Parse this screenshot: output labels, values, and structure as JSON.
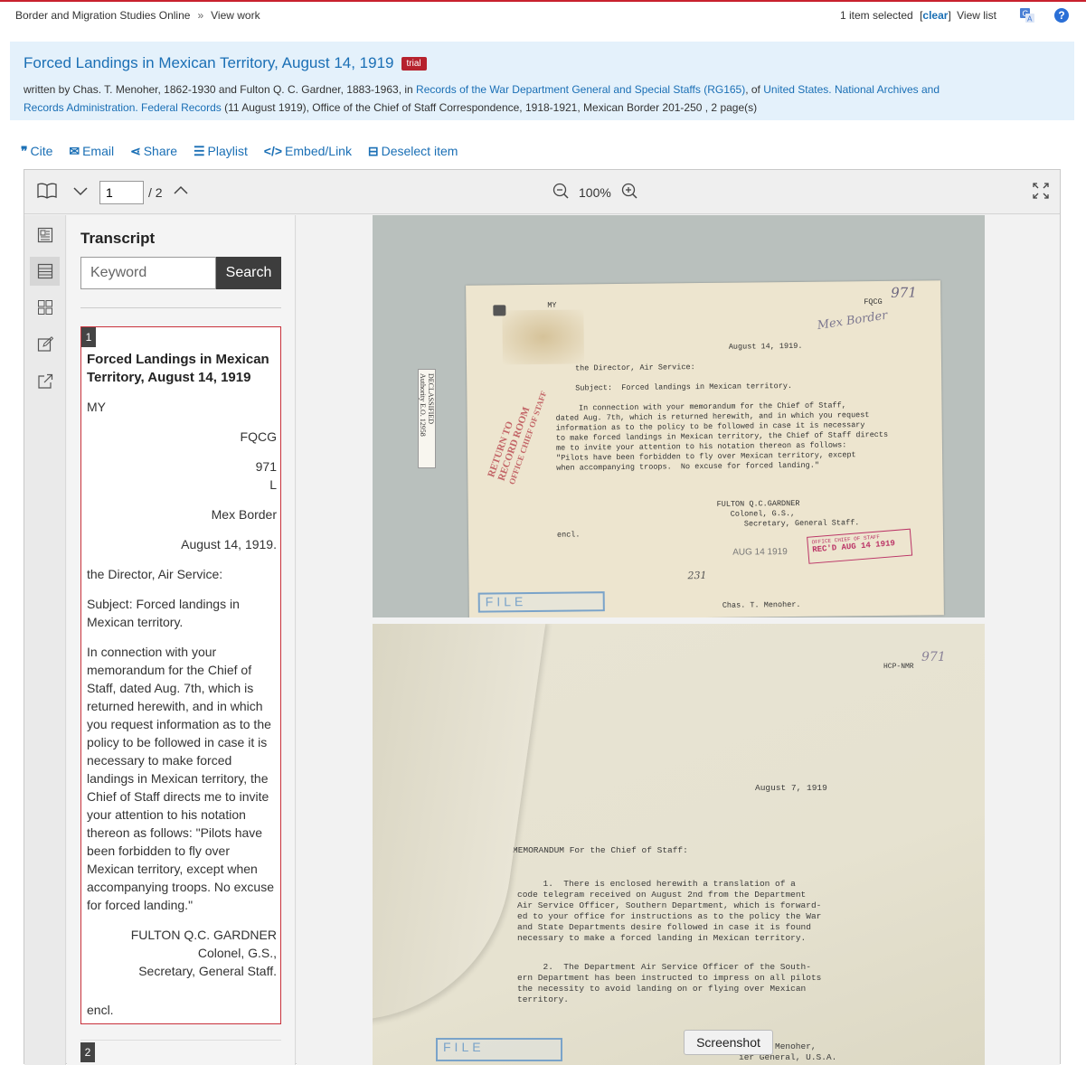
{
  "topbar": {
    "site": "Border and Migration Studies Online",
    "separator": "»",
    "current": "View work",
    "selected_count": "1 item selected",
    "bracket_open": "[",
    "clear": "clear",
    "bracket_close": "]",
    "view_list": "View list",
    "help": "?"
  },
  "header": {
    "title": "Forced Landings in Mexican Territory, August 14, 1919",
    "badge": "trial",
    "citation_prefix": "written by Chas. T. Menoher, 1862-1930 and Fulton Q. C. Gardner, 1883-1963, in ",
    "citation_link1": "Records of the War Department General and Special Staffs (RG165)",
    "citation_mid": ", of ",
    "citation_link2": "United States. National Archives and Records Administration. Federal Records",
    "citation_suffix": " (11 August 1919), Office of the Chief of Staff Correspondence, 1918-1921, Mexican Border 201-250 , 2 page(s)"
  },
  "actions": {
    "cite": "Cite",
    "email": "Email",
    "share": "Share",
    "playlist": "Playlist",
    "embed": "Embed/Link",
    "deselect": "Deselect item"
  },
  "viewer": {
    "page_value": "1",
    "page_total": "/ 2",
    "zoom": "100%"
  },
  "transcript": {
    "title": "Transcript",
    "keyword_placeholder": "Keyword",
    "search_label": "Search",
    "page1": {
      "number": "1",
      "title": "Forced Landings in Mexican Territory, August 14, 1919",
      "l1": "MY",
      "l2": "FQCG",
      "l3": "971",
      "l4": "L",
      "l5": "Mex Border",
      "l6": "August 14, 1919.",
      "l7": "the Director, Air Service:",
      "l8": "Subject: Forced landings in Mexican territory.",
      "l9": "In connection with your memorandum for the Chief of Staff, dated Aug. 7th, which is returned herewith, and in which you request information as to the policy to be followed in case it is necessary to make forced landings in Mexican territory, the Chief of Staff directs me to invite your attention to his notation thereon as follows: \"Pilots have been forbidden to fly over Mexican territory, except when accompanying troops. No excuse for forced landing.\"",
      "l10": "FULTON Q.C. GARDNER",
      "l11": "Colonel, G.S.,",
      "l12": "Secretary, General Staff.",
      "l13": "encl."
    },
    "page2_number": "2"
  },
  "scan1": {
    "my": "MY",
    "fqcg": "FQCG",
    "hand_971": "971",
    "hand_mex": "Mex Border",
    "date": "August 14, 1919.",
    "to": "the Director, Air Service:",
    "subject": "Subject:  Forced landings in Mexican territory.",
    "body1": "     In connection with your memorandum for the Chief of Staff,",
    "body2": "dated Aug. 7th, which is returned herewith, and in which you request",
    "body3": "information as to the policy to be followed in case it is necessary",
    "body4": "to make forced landings in Mexican territory, the Chief of Staff directs",
    "body5": "me to invite your attention to his notation thereon as follows:",
    "body6": "\"Pilots have been forbidden to fly over Mexican territory, except",
    "body7": "when accompanying troops.  No excuse for forced landing.\"",
    "sig1": "FULTON Q.C.GARDNER",
    "sig2": "Colonel, G.S.,",
    "sig3": "Secretary, General Staff.",
    "encl": "encl.",
    "aug_stamp": "AUG 14 1919",
    "office_stamp": "OFFICE CHIEF OF STAFF",
    "recd_stamp": "REC'D  AUG 14 1919",
    "return_stamp1": "RETURN TO",
    "return_stamp2": "RECORD ROOM",
    "return_stamp3": "OFFICE CHIEF OF STAFF",
    "declassified": "DECLASSIFIED",
    "authority": "Authority E.O. 12958",
    "num231": "231",
    "file": "FILE",
    "menoher": "Chas. T. Menoher."
  },
  "scan2": {
    "code": "HCP-NMR",
    "hand_971": "971",
    "date": "August 7, 1919",
    "memo": "MEMORANDUM For the Chief of Staff:",
    "p1a": "     1.  There is enclosed herewith a translation of a",
    "p1b": "code telegram received on August 2nd from the Department",
    "p1c": "Air Service Officer, Southern Department, which is forward-",
    "p1d": "ed to your office for instructions as to the policy the War",
    "p1e": "and State Departments desire followed in case it is found",
    "p1f": "necessary to make a forced landing in Mexican territory.",
    "p2a": "     2.  The Department Air Service Officer of the South-",
    "p2b": "ern Department has been instructed to impress on all pilots",
    "p2c": "the necessity to avoid landing on or flying over Mexican",
    "p2d": "territory.",
    "sig1": "Menoher,",
    "sig2": "ier General, U.S.A.",
    "file": "FILE"
  },
  "tooltip": "Screenshot"
}
